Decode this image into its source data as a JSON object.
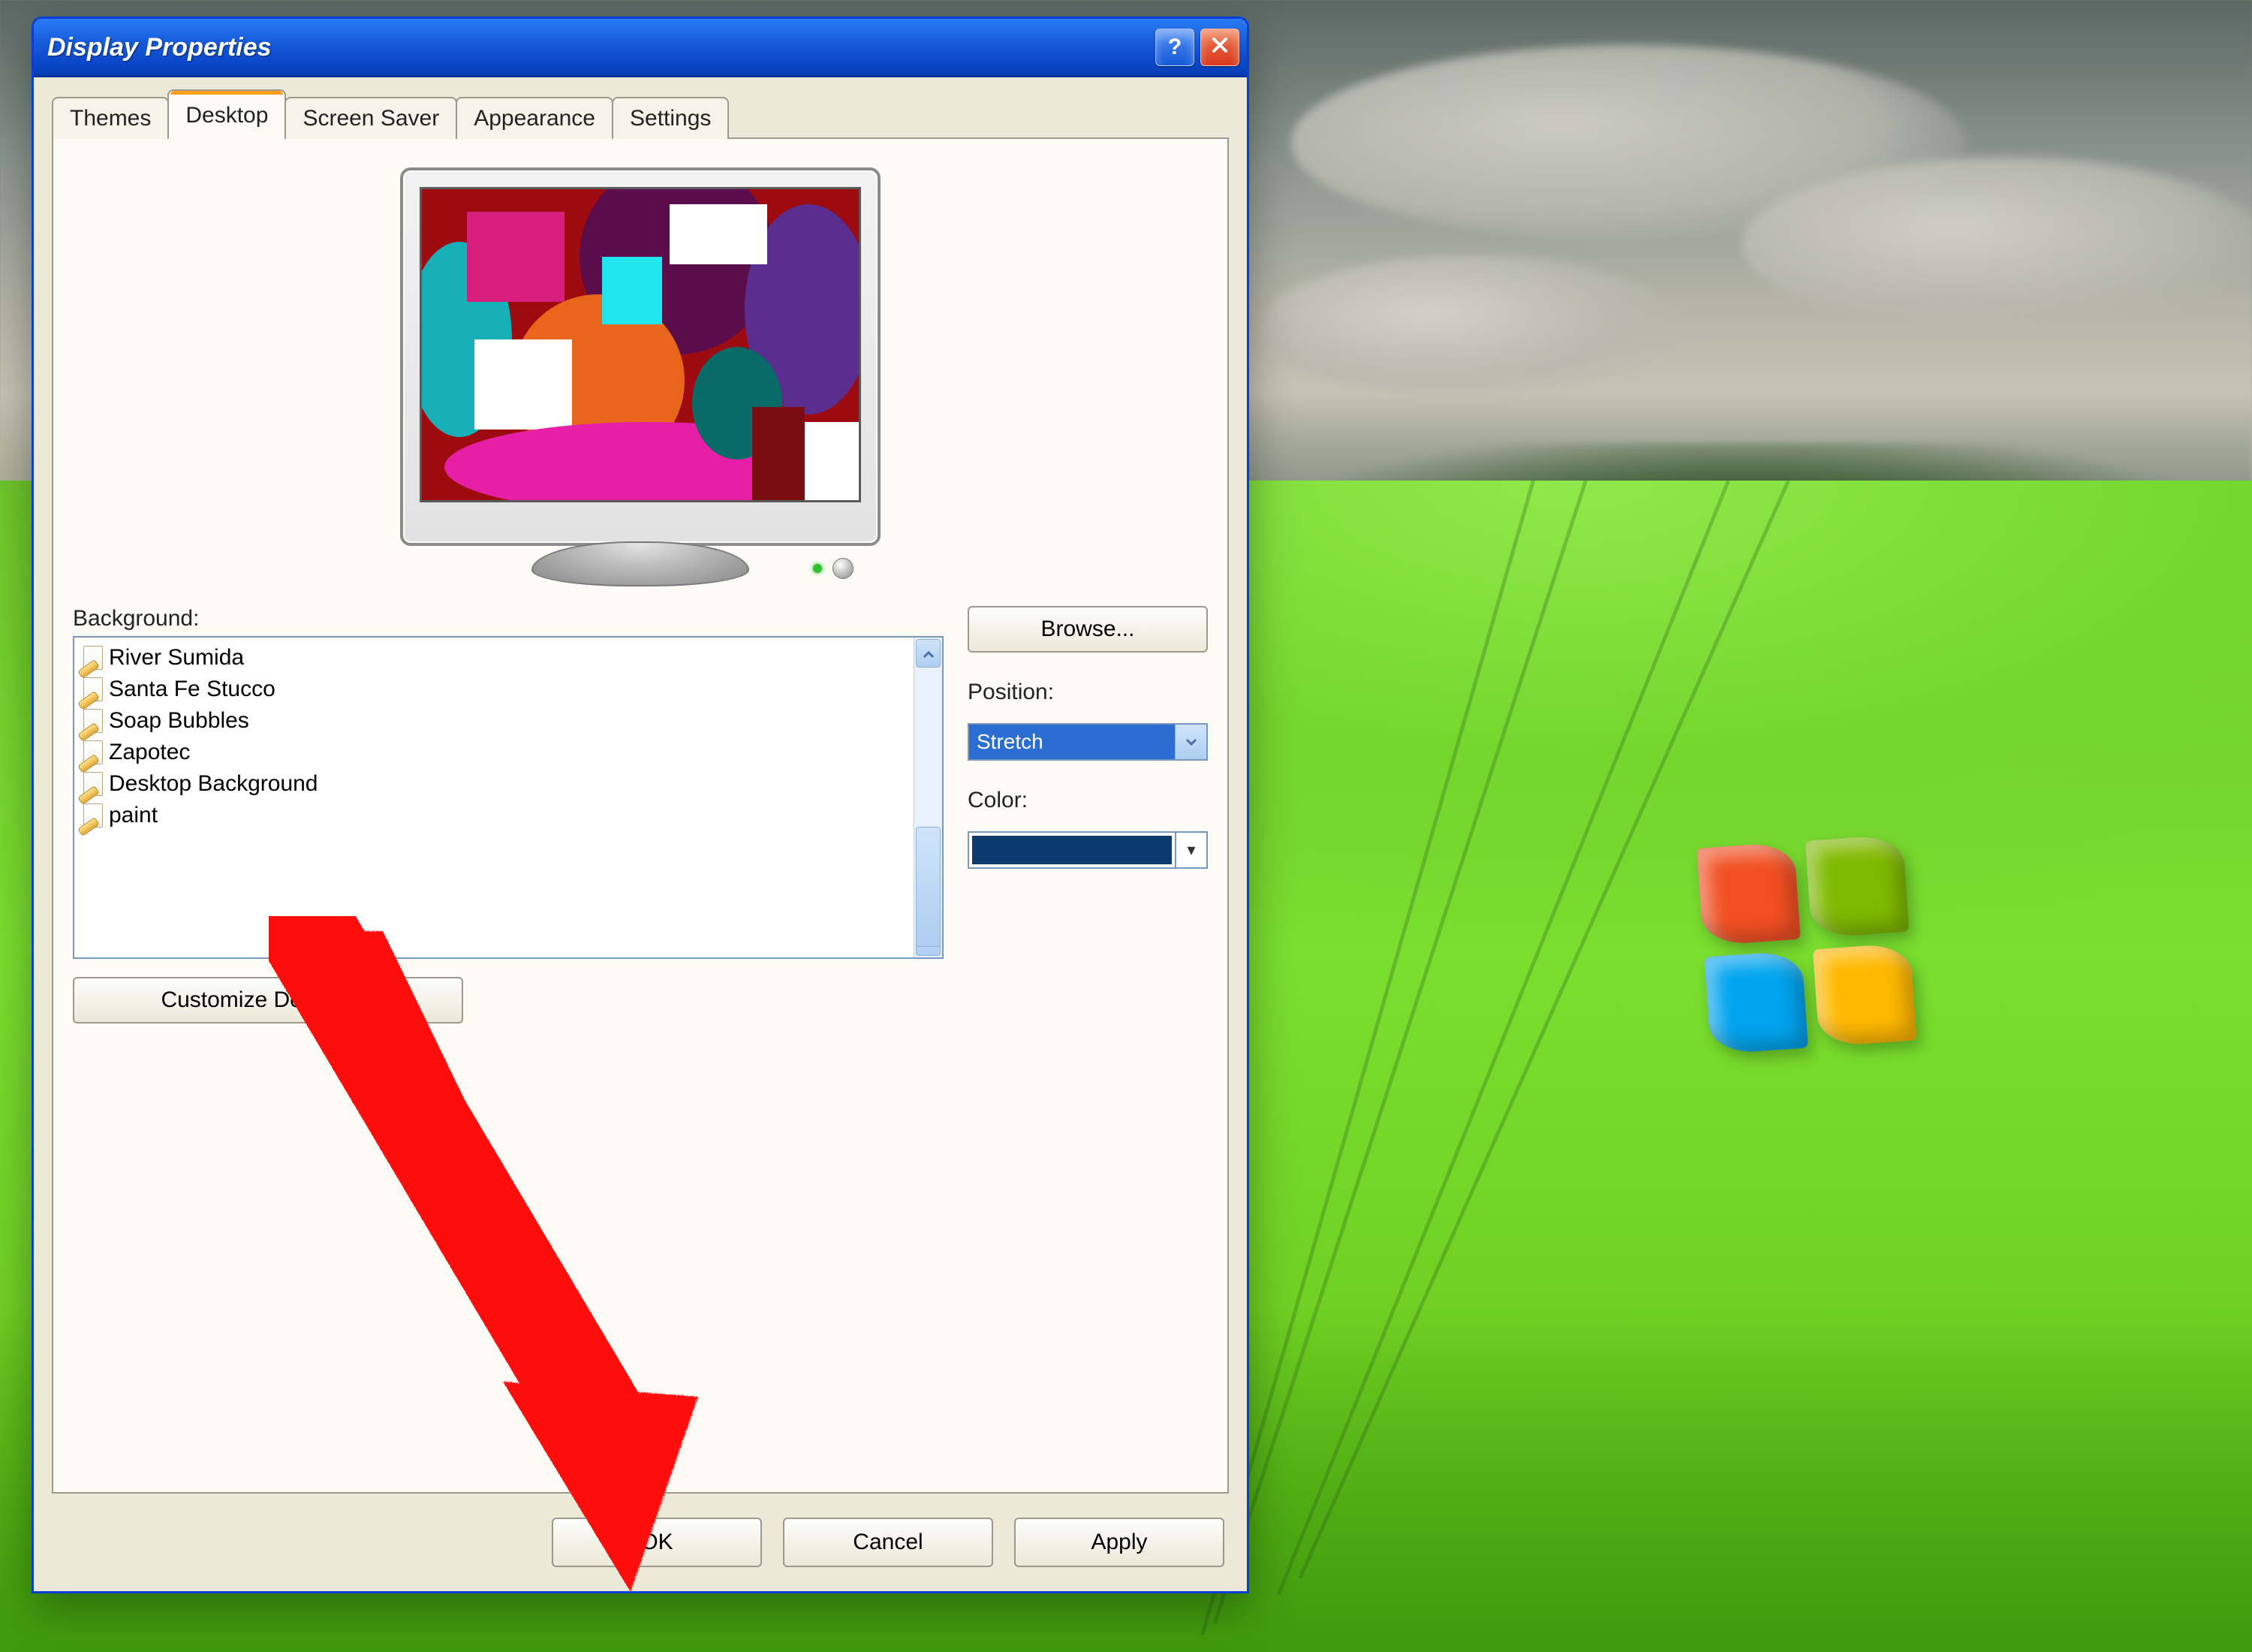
{
  "dialog": {
    "title": "Display Properties",
    "tabs": [
      "Themes",
      "Desktop",
      "Screen Saver",
      "Appearance",
      "Settings"
    ],
    "active_tab_index": 1
  },
  "desktop_tab": {
    "background_label": "Background:",
    "background_items": [
      "River Sumida",
      "Santa Fe Stucco",
      "Soap Bubbles",
      "Zapotec",
      "Desktop Background",
      "paint"
    ],
    "customize_label": "Customize Desktop...",
    "browse_label": "Browse...",
    "position_label": "Position:",
    "position_value": "Stretch",
    "color_label": "Color:",
    "color_value": "#0d3a6e"
  },
  "buttons": {
    "ok": "OK",
    "cancel": "Cancel",
    "apply": "Apply"
  },
  "titlebar": {
    "help_tooltip": "?",
    "close_tooltip": "X"
  }
}
